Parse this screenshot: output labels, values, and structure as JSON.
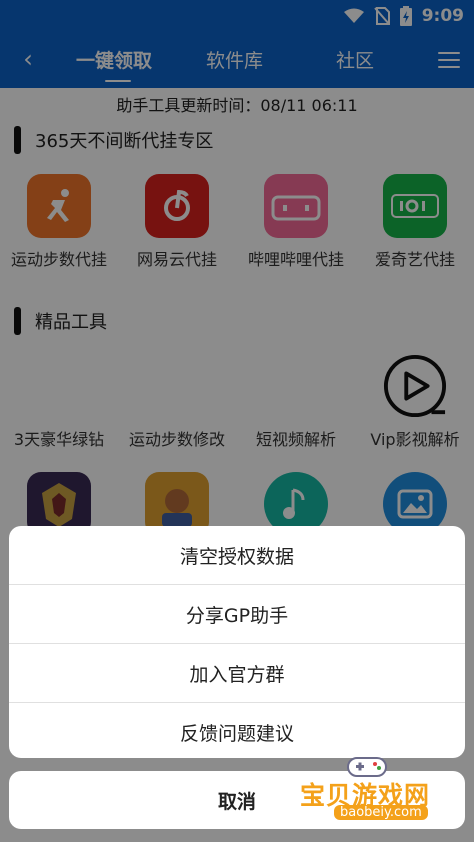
{
  "statusbar": {
    "time": "9:09"
  },
  "nav": {
    "back_icon": "back-arrow-icon",
    "tabs": [
      {
        "label": "一键领取",
        "active": true
      },
      {
        "label": "软件库",
        "active": false
      },
      {
        "label": "社区",
        "active": false
      }
    ],
    "menu_icon": "hamburger-menu-icon"
  },
  "update_time": "助手工具更新时间：08/11 06:11",
  "section1": {
    "title": "365天不间断代挂专区",
    "apps": [
      {
        "label": "运动步数代挂",
        "icon": "running-icon",
        "color": "#f0762b"
      },
      {
        "label": "网易云代挂",
        "icon": "netease-music-icon",
        "color": "#d9221e"
      },
      {
        "label": "哔哩哔哩代挂",
        "icon": "bilibili-icon",
        "color": "#f56b97"
      },
      {
        "label": "爱奇艺代挂",
        "icon": "iqiyi-icon",
        "color": "#16b54a"
      }
    ]
  },
  "section2": {
    "title": "精品工具",
    "apps": [
      {
        "label": "3天豪华绿钻",
        "icon": "green-diamond-icon"
      },
      {
        "label": "运动步数修改",
        "icon": "steps-edit-icon"
      },
      {
        "label": "短视频解析",
        "icon": "video-parse-icon"
      },
      {
        "label": "Vip影视解析",
        "icon": "play-icon"
      }
    ],
    "row2_icons": [
      "game-emblem-icon",
      "game-hero-icon",
      "music-note-icon",
      "image-icon"
    ]
  },
  "sheet": {
    "items": [
      "清空授权数据",
      "分享GP助手",
      "加入官方群",
      "反馈问题建议"
    ],
    "cancel": "取消"
  },
  "watermark": {
    "title": "宝贝游戏网",
    "url": "baobeiy.com"
  }
}
